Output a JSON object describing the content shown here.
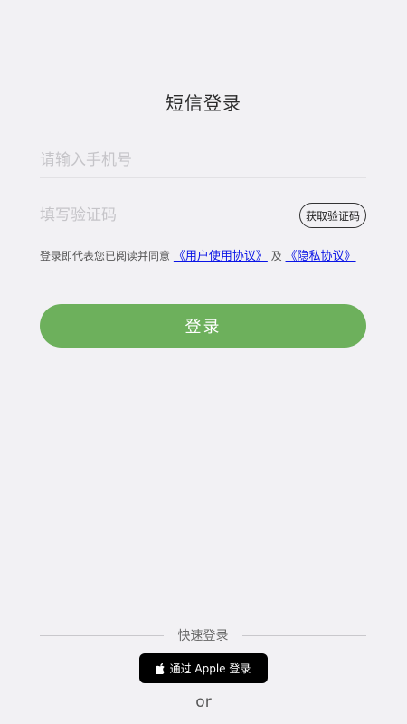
{
  "page": {
    "title": "短信登录"
  },
  "form": {
    "phone_placeholder": "请输入手机号",
    "code_placeholder": "填写验证码",
    "get_code_label": "获取验证码",
    "agreement_prefix": "登录即代表您已阅读并同意",
    "user_agreement": "《用户使用协议》",
    "agreement_and": "及",
    "privacy_policy": "《隐私协议》",
    "login_label": "登录"
  },
  "quick_login": {
    "label": "快速登录",
    "apple_label": "通过 Apple 登录",
    "apple_icon": "apple-icon",
    "or_label": "or"
  },
  "colors": {
    "background": "#f2f1f4",
    "primary_button": "#6db05c",
    "link": "#0a14e6",
    "apple_button": "#000000"
  }
}
